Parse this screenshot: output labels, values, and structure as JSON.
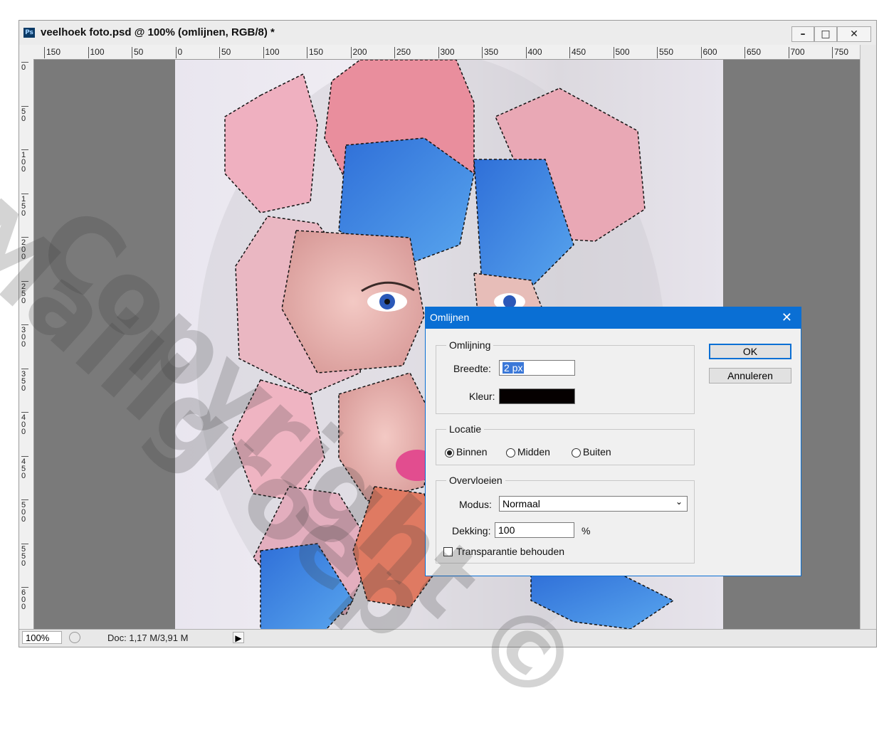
{
  "window": {
    "app_icon": "Ps",
    "title": "veelhoek foto.psd @ 100% (omlijnen, RGB/8) *",
    "minimize": "–",
    "maximize": "□",
    "close": "✕"
  },
  "ruler": {
    "h_labels": [
      "150",
      "100",
      "50",
      "0",
      "50",
      "100",
      "150",
      "200",
      "250",
      "300",
      "350",
      "400",
      "450",
      "500",
      "550",
      "600",
      "650",
      "700",
      "750"
    ],
    "v_labels": [
      "0",
      "50",
      "100",
      "150",
      "200",
      "250",
      "300",
      "350",
      "400",
      "450",
      "500",
      "550",
      "600"
    ]
  },
  "status": {
    "zoom": "100%",
    "doc": "Doc: 1,17 M/3,91 M",
    "arrow": "▶"
  },
  "dialog": {
    "title": "Omlijnen",
    "close": "✕",
    "stroke_group": "Omlijning",
    "width_label": "Breedte:",
    "width_value": "2 px",
    "color_label": "Kleur:",
    "color_value": "#050000",
    "location_group": "Locatie",
    "loc_inside": "Binnen",
    "loc_center": "Midden",
    "loc_outside": "Buiten",
    "loc_selected": "Binnen",
    "blend_group": "Overvloeien",
    "mode_label": "Modus:",
    "mode_value": "Normaal",
    "opacity_label": "Dekking:",
    "opacity_value": "100",
    "opacity_unit": "%",
    "preserve_label": "Transparantie behouden",
    "preserve_checked": false,
    "ok": "OK",
    "cancel": "Annuleren"
  },
  "watermark": {
    "line1": "Copyright ©",
    "line2": "Maillgroep"
  }
}
